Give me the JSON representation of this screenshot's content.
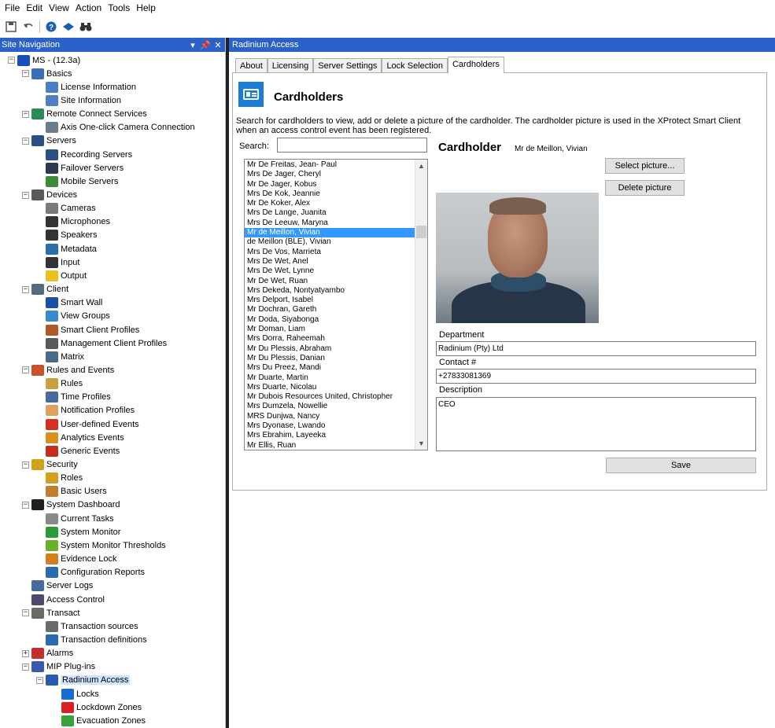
{
  "menu": [
    "File",
    "Edit",
    "View",
    "Action",
    "Tools",
    "Help"
  ],
  "toolbar": {
    "icons": [
      "save-icon",
      "undo-icon",
      "help-icon",
      "export-icon",
      "binoculars-icon"
    ]
  },
  "site_nav": {
    "title": "Site Navigation",
    "pin": "↓ &#x2195;",
    "rows": [
      {
        "label": "MS - (12.3a)",
        "level": 0,
        "exp": "minus",
        "icon": "server-root-icon",
        "color": "#1a4fb5"
      },
      {
        "label": "Basics",
        "level": 1,
        "exp": "minus",
        "icon": "book-icon",
        "color": "#3a6fb8"
      },
      {
        "label": "License Information",
        "level": 2,
        "icon": "license-icon",
        "color": "#4d7fc2"
      },
      {
        "label": "Site Information",
        "level": 2,
        "icon": "site-info-icon",
        "color": "#4d7fc2"
      },
      {
        "label": "Remote Connect Services",
        "level": 1,
        "exp": "minus",
        "icon": "remote-connect-icon",
        "color": "#2a8a5a"
      },
      {
        "label": "Axis One-click Camera Connection",
        "level": 2,
        "icon": "axis-camera-icon",
        "color": "#6b7c8a"
      },
      {
        "label": "Servers",
        "level": 1,
        "exp": "minus",
        "icon": "servers-icon",
        "color": "#2c4f86"
      },
      {
        "label": "Recording Servers",
        "level": 2,
        "icon": "recording-server-icon",
        "color": "#2c4f86"
      },
      {
        "label": "Failover Servers",
        "level": 2,
        "icon": "failover-server-icon",
        "color": "#2b3b4e"
      },
      {
        "label": "Mobile Servers",
        "level": 2,
        "icon": "mobile-server-icon",
        "color": "#3d8a3d"
      },
      {
        "label": "Devices",
        "level": 1,
        "exp": "minus",
        "icon": "devices-icon",
        "color": "#5a5a5a"
      },
      {
        "label": "Cameras",
        "level": 2,
        "icon": "camera-icon",
        "color": "#7a7a7a"
      },
      {
        "label": "Microphones",
        "level": 2,
        "icon": "microphone-icon",
        "color": "#333333"
      },
      {
        "label": "Speakers",
        "level": 2,
        "icon": "speaker-icon",
        "color": "#333333"
      },
      {
        "label": "Metadata",
        "level": 2,
        "icon": "metadata-icon",
        "color": "#2a6fa8"
      },
      {
        "label": "Input",
        "level": 2,
        "icon": "input-icon",
        "color": "#333333"
      },
      {
        "label": "Output",
        "level": 2,
        "icon": "output-icon",
        "color": "#e8c020"
      },
      {
        "label": "Client",
        "level": 1,
        "exp": "minus",
        "icon": "client-icon",
        "color": "#5a6a7a"
      },
      {
        "label": "Smart Wall",
        "level": 2,
        "icon": "smart-wall-icon",
        "color": "#1c4fa0"
      },
      {
        "label": "View Groups",
        "level": 2,
        "icon": "view-groups-icon",
        "color": "#3a8ad0"
      },
      {
        "label": "Smart Client Profiles",
        "level": 2,
        "icon": "smart-client-profile-icon",
        "color": "#b05a2a"
      },
      {
        "label": "Management Client Profiles",
        "level": 2,
        "icon": "management-client-profile-icon",
        "color": "#5a5a5a"
      },
      {
        "label": "Matrix",
        "level": 2,
        "icon": "matrix-icon",
        "color": "#4a6a8a"
      },
      {
        "label": "Rules and Events",
        "level": 1,
        "exp": "minus",
        "icon": "rules-events-icon",
        "color": "#c8502a"
      },
      {
        "label": "Rules",
        "level": 2,
        "icon": "rules-icon",
        "color": "#c8a040"
      },
      {
        "label": "Time Profiles",
        "level": 2,
        "icon": "time-profile-icon",
        "color": "#4a6a9a"
      },
      {
        "label": "Notification Profiles",
        "level": 2,
        "icon": "notification-profile-icon",
        "color": "#e0a060"
      },
      {
        "label": "User-defined Events",
        "level": 2,
        "icon": "user-event-icon",
        "color": "#d83020"
      },
      {
        "label": "Analytics Events",
        "level": 2,
        "icon": "analytics-event-icon",
        "color": "#d89020"
      },
      {
        "label": "Generic Events",
        "level": 2,
        "icon": "generic-event-icon",
        "color": "#c03020"
      },
      {
        "label": "Security",
        "level": 1,
        "exp": "minus",
        "icon": "security-icon",
        "color": "#d0a020"
      },
      {
        "label": "Roles",
        "level": 2,
        "icon": "roles-icon",
        "color": "#d0a020"
      },
      {
        "label": "Basic Users",
        "level": 2,
        "icon": "basic-users-icon",
        "color": "#c08030"
      },
      {
        "label": "System Dashboard",
        "level": 1,
        "exp": "minus",
        "icon": "dashboard-icon",
        "color": "#202020"
      },
      {
        "label": "Current Tasks",
        "level": 2,
        "icon": "current-tasks-icon",
        "color": "#8a8a8a"
      },
      {
        "label": "System Monitor",
        "level": 2,
        "icon": "system-monitor-icon",
        "color": "#2a9a3a"
      },
      {
        "label": "System Monitor Thresholds",
        "level": 2,
        "icon": "thresholds-icon",
        "color": "#6ab02a"
      },
      {
        "label": "Evidence Lock",
        "level": 2,
        "icon": "evidence-lock-icon",
        "color": "#d08020"
      },
      {
        "label": "Configuration Reports",
        "level": 2,
        "icon": "config-report-icon",
        "color": "#2a6ab0"
      },
      {
        "label": "Server Logs",
        "level": 1,
        "icon": "server-logs-icon",
        "color": "#4a6a9a"
      },
      {
        "label": "Access Control",
        "level": 1,
        "icon": "access-control-icon",
        "color": "#4a4a6a"
      },
      {
        "label": "Transact",
        "level": 1,
        "exp": "minus",
        "icon": "transact-icon",
        "color": "#6a6a6a"
      },
      {
        "label": "Transaction sources",
        "level": 2,
        "icon": "transaction-source-icon",
        "color": "#6a6a6a"
      },
      {
        "label": "Transaction definitions",
        "level": 2,
        "icon": "transaction-definition-icon",
        "color": "#2a6ab0"
      },
      {
        "label": "Alarms",
        "level": 1,
        "exp": "plus",
        "icon": "alarms-icon",
        "color": "#c03030"
      },
      {
        "label": "MIP Plug-ins",
        "level": 1,
        "exp": "minus",
        "icon": "mip-plugins-icon",
        "color": "#3a5ab0"
      },
      {
        "label": "Radinium Access",
        "level": 2,
        "exp": "minus",
        "icon": "radinium-icon",
        "color": "#2a5ab0",
        "selected": true
      },
      {
        "label": "Locks",
        "level": 3,
        "icon": "locks-icon",
        "color": "#1c6ad0"
      },
      {
        "label": "Lockdown Zones",
        "level": 3,
        "icon": "lockdown-zone-icon",
        "color": "#d82020"
      },
      {
        "label": "Evacuation Zones",
        "level": 3,
        "icon": "evacuation-zone-icon",
        "color": "#3aa03a"
      }
    ]
  },
  "main": {
    "header": "Radinium Access",
    "tabs": [
      "About",
      "Licensing",
      "Server Settings",
      "Lock Selection",
      "Cardholders"
    ],
    "active_tab": "Cardholders",
    "section_title": "Cardholders",
    "description": "Search for cardholders to view, add or delete a picture of the cardholder. The cardholder picture is used in the XProtect Smart Client when an access control event has been registered.",
    "search_label": "Search:",
    "search_value": "",
    "cardholders": [
      "Mr De Freitas, Jean- Paul",
      "Mrs De Jager, Cheryl",
      "Mr De Jager, Kobus",
      "Mrs De Kok, Jeannie",
      "Mr De Koker, Alex",
      "Mrs De Lange, Juanita",
      "Mrs De Leeuw, Maryna",
      "Mr de Meillon, Vivian",
      " de Meillon (BLE), Vivian",
      "Mrs De Vos, Marrieta",
      "Mrs De Wet, Anel",
      "Mrs De Wet, Lynne",
      "Mr De Wet, Ruan",
      "Mrs Dekeda, Nontyatyambo",
      "Mrs Delport, Isabel",
      "Mr Dochran, Gareth",
      "Mr Doda, Siyabonga",
      "Mr Doman, Liam",
      "Mrs Dorra, Raheemah",
      "Mr Du Plessis, Abraham",
      "Mr Du Plessis, Danian",
      "Mrs Du Preez, Mandi",
      "Mr Duarte, Martin",
      "Mrs Duarte, Nicolau",
      "Mr Dubois Resources United, Christopher",
      "Mrs Dumzela, Nowellie",
      "MRS Dunjwa, Nancy",
      "Mrs Dyonase, Lwando",
      "Mrs Ebrahim, Layeeka",
      "Mr Ellis, Ruan"
    ],
    "selected_index": 7,
    "cardholder_heading": "Cardholder",
    "cardholder_name": "Mr de Meillon, Vivian",
    "select_picture": "Select picture...",
    "delete_picture": "Delete picture",
    "department_label": "Department",
    "department_value": "Radinium (Pty) Ltd",
    "contact_label": "Contact #",
    "contact_value": "+27833081369",
    "description_label": "Description",
    "description_value": "CEO",
    "save": "Save"
  }
}
